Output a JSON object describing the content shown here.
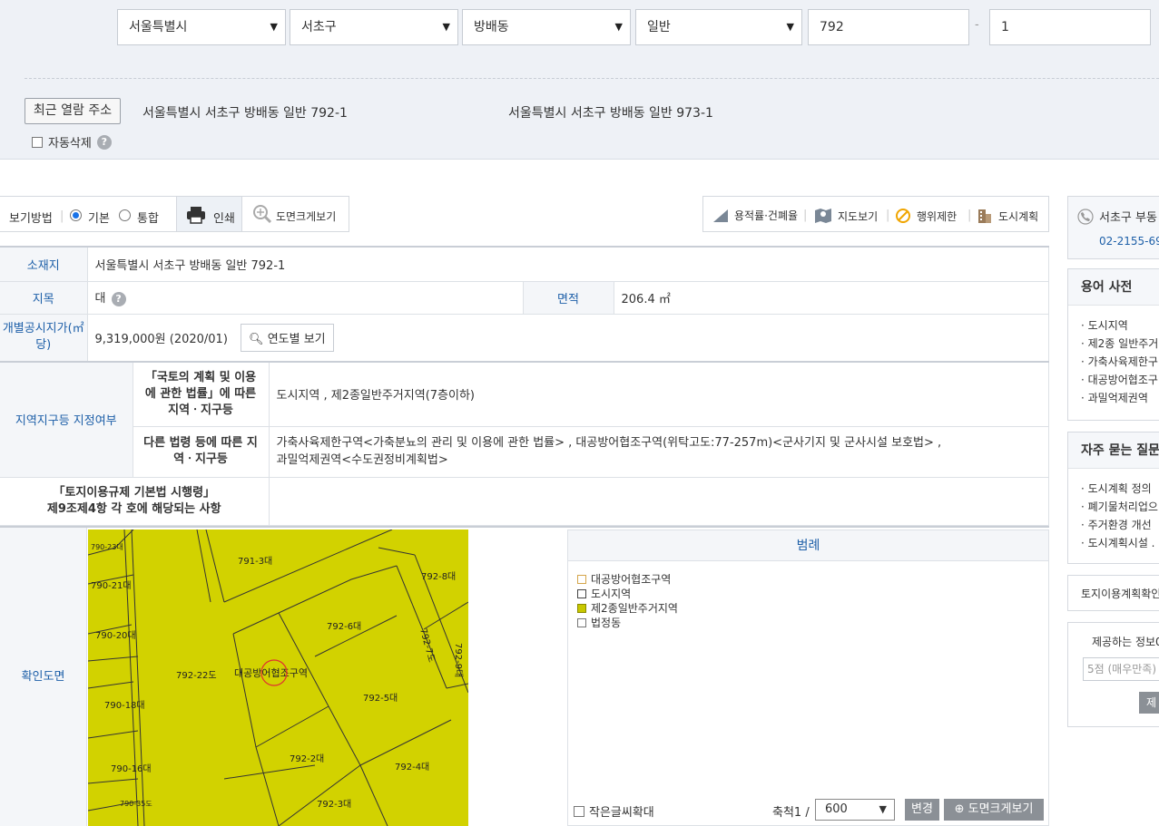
{
  "filters": {
    "city": "서울특별시",
    "district": "서초구",
    "dong": "방배동",
    "land_type": "일반",
    "main_no": "792",
    "dash": "-",
    "sub_no": "1"
  },
  "recent": {
    "button_label": "최근 열람 주소",
    "items": [
      "서울특별시 서초구 방배동 일반 792-1",
      "서울특별시 서초구 방배동 일반 973-1"
    ],
    "auto_delete_label": "자동삭제",
    "help_icon": "?"
  },
  "view_bar": {
    "label": "보기방법",
    "options": [
      "기본",
      "통합"
    ],
    "selected": "기본",
    "print_label": "인쇄",
    "zoom_label": "도면크게보기"
  },
  "toolbar": {
    "items": [
      "용적률·건폐율",
      "지도보기",
      "행위제한",
      "도시계획"
    ]
  },
  "info": {
    "location_label": "소재지",
    "location_value": "서울특별시 서초구 방배동 일반 792-1",
    "jimok_label": "지목",
    "jimok_value": "대",
    "area_label": "면적",
    "area_value": "206.4 ㎡",
    "price_label": "개별공시지가(㎡당)",
    "price_value": "9,319,000원 (2020/01)",
    "price_button": "연도별 보기",
    "zone_label": "지역지구등 지정여부",
    "law1_label": "「국토의 계획 및 이용에 관한 법률」에 따른 지역ㆍ지구등",
    "law1_value": "도시지역 , 제2종일반주거지역(7층이하)",
    "law2_label": "다른 법령 등에 따른 지역ㆍ지구등",
    "law2_value_line1": "가축사육제한구역<가축분뇨의 관리 및 이용에 관한 법률> , 대공방어협조구역(위탁고도:77-257m)<군사기지 및 군사시설 보호법> ,",
    "law2_value_line2": "과밀억제권역<수도권정비계획법>",
    "rule_label_line1": "「토지이용규제 기본법 시행령」",
    "rule_label_line2": "제9조제4항 각 호에 해당되는 사항",
    "rule_value": ""
  },
  "map": {
    "label": "확인도면",
    "parcels": [
      "791-3대",
      "792-8대",
      "790-21대",
      "792-6대",
      "790-20대",
      "792-22도",
      "792-7도",
      "792-9대",
      "대공방어협조구역",
      "792-5대",
      "790-18대",
      "792-2대",
      "792-4대",
      "790-16대",
      "792-3대",
      "790-23대",
      "790-35도"
    ],
    "legend_title": "범례",
    "legend": [
      {
        "label": "대공방어협조구역",
        "color": "#ffffff",
        "border": "#d4a54a"
      },
      {
        "label": "도시지역",
        "color": "#ffffff",
        "border": "#444444"
      },
      {
        "label": "제2종일반주거지역",
        "color": "#c8c800",
        "border": "#8a8a00"
      },
      {
        "label": "법정동",
        "color": "#ffffff",
        "border": "#777777"
      }
    ],
    "small_text_label": "작은글씨확대",
    "scale_label": "축척1 /",
    "scale_value": "600",
    "change_button": "변경",
    "zoom_button": "도면크게보기"
  },
  "sidebar": {
    "contact_office": "서초구 부동",
    "contact_phone": "02-2155-69",
    "glossary_title": "용어 사전",
    "glossary": [
      "· 도시지역",
      "· 제2종 일반주거",
      "· 가축사육제한구",
      "· 대공방어협조구",
      "· 과밀억제권역"
    ],
    "faq_title": "자주 묻는 질문",
    "faq": [
      "· 도시계획 정의",
      "· 폐기물처리업으",
      "· 주거환경 개선",
      "· 도시계획시설 ."
    ],
    "confirm_link": "토지이용계획확인",
    "rating_title": "제공하는 정보0",
    "rating_placeholder": "5점 (매우만족)",
    "submit_label": "제"
  },
  "colors": {
    "accent": "#1d5fa8",
    "map_fill": "#d2d200",
    "top_bg": "#eef1f6"
  }
}
